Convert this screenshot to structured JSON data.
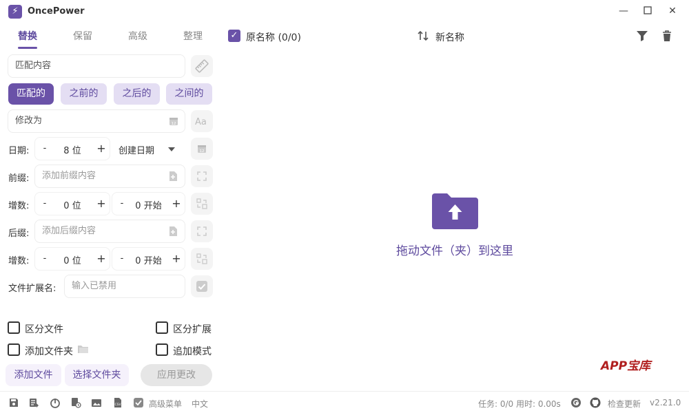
{
  "window": {
    "title": "OncePower"
  },
  "tabs": [
    "替换",
    "保留",
    "高级",
    "整理"
  ],
  "replace": {
    "match_value": "匹配内容",
    "modes": [
      "匹配的",
      "之前的",
      "之后的",
      "之间的"
    ],
    "modify_value": "修改为",
    "date_label": "日期:",
    "date_digits": "8 位",
    "date_type": "创建日期",
    "prefix_label": "前缀:",
    "prefix_placeholder": "添加前缀内容",
    "increment_label": "增数:",
    "inc1_digits": "0 位",
    "inc1_start": "0 开始",
    "suffix_label": "后缀:",
    "suffix_placeholder": "添加后缀内容",
    "inc2_digits": "0 位",
    "inc2_start": "0 开始",
    "extension_label": "文件扩展名:",
    "extension_placeholder": "输入已禁用"
  },
  "options": {
    "distinguish_file": "区分文件",
    "distinguish_extension": "区分扩展",
    "add_folder": "添加文件夹",
    "append_mode": "追加模式"
  },
  "actions": {
    "add_file": "添加文件",
    "select_folder": "选择文件夹",
    "apply": "应用更改"
  },
  "list": {
    "original_label": "原名称 (0/0)",
    "new_label": "新名称"
  },
  "dropzone": {
    "text": "拖动文件（夹）到这里"
  },
  "watermark": "APP宝库",
  "status": {
    "advanced_menu": "高级菜单",
    "language": "中文",
    "task": "任务: 0/0 用时: 0.00s",
    "check_update": "检查更新",
    "version": "v2.21.0"
  },
  "colors": {
    "accent": "#6a52a8",
    "accent_light": "#e4def3",
    "watermark": "#b01e1e"
  },
  "icons": [
    "app-logo",
    "ruler",
    "calendar",
    "text-case",
    "file-insert",
    "reset",
    "sort-order",
    "checkbox",
    "folder",
    "swap-sort",
    "filter",
    "delete",
    "upload-folder",
    "save",
    "edit-list",
    "power",
    "file-time",
    "image",
    "csv",
    "g-logo",
    "github"
  ]
}
